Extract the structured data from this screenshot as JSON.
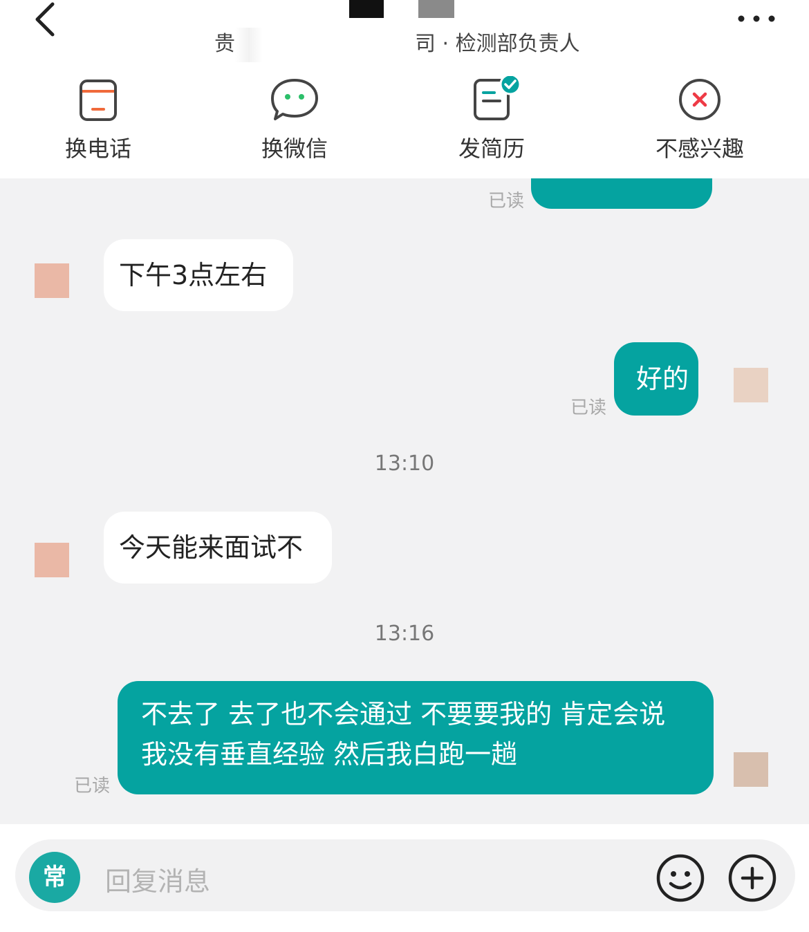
{
  "header": {
    "subtitle_start": "贵",
    "subtitle_end": "司 · 检测部负责人"
  },
  "actions": [
    {
      "label": "换电话",
      "icon": "phone-icon"
    },
    {
      "label": "换微信",
      "icon": "wechat-icon"
    },
    {
      "label": "发简历",
      "icon": "resume-icon"
    },
    {
      "label": "不感兴趣",
      "icon": "not-interested-icon"
    }
  ],
  "chat": {
    "messages": [
      {
        "from": "me",
        "text": "",
        "status": "已读"
      },
      {
        "from": "them",
        "text": "下午3点左右"
      },
      {
        "from": "me",
        "text": "好的",
        "status": "已读"
      },
      {
        "from": "them",
        "text": "今天能来面试不"
      },
      {
        "from": "me",
        "text": "不去了 去了也不会通过 不要要我的 肯定会说 我没有垂直经验 然后我白跑一趟",
        "lines": [
          "不去了 去了也不会通过 不要要我的 肯定会说",
          "我没有垂直经验 然后我白跑一趟"
        ],
        "status": "已读"
      }
    ],
    "times": [
      "13:10",
      "13:16"
    ]
  },
  "input": {
    "quick_reply": "常",
    "placeholder": "回复消息"
  },
  "colors": {
    "accent": "#05a3a0",
    "chat_bg": "#f2f2f3",
    "avatar_them": "#eab8a6",
    "avatar_me": "#e9d2c3"
  }
}
